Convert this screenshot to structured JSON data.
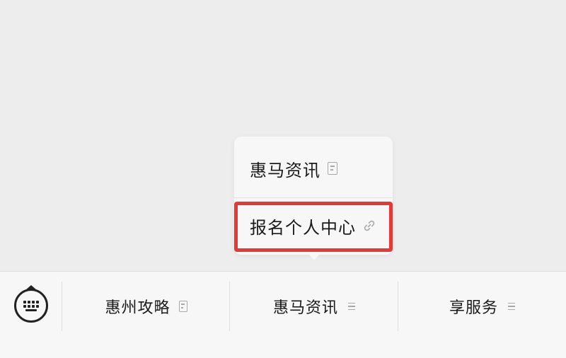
{
  "popup": {
    "items": [
      {
        "label": "惠马资讯",
        "icon": "document-icon"
      },
      {
        "label": "报名个人中心",
        "icon": "link-icon",
        "highlighted": true
      }
    ]
  },
  "menu_bar": {
    "keyboard_icon": "keyboard-icon",
    "items": [
      {
        "label": "惠州攻略",
        "icon": "document-icon"
      },
      {
        "label": "惠马资讯",
        "icon": "menu-lines-icon"
      },
      {
        "label": "享服务",
        "icon": "menu-lines-icon"
      }
    ]
  },
  "colors": {
    "background": "#ededed",
    "menu_bar_bg": "#f7f7f7",
    "highlight": "#e53935"
  }
}
